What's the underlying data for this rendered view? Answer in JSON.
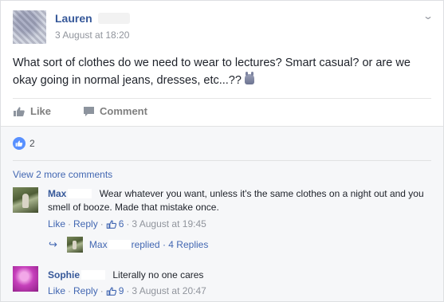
{
  "post": {
    "author": "Lauren",
    "time": "3 August at 18:20",
    "text": "What sort of clothes do we need to wear to lectures? Smart casual? or are we okay going in normal jeans, dresses, etc...??",
    "emoji_icon": "bunny-emoji-icon"
  },
  "actions": {
    "like": "Like",
    "comment": "Comment"
  },
  "reactions": {
    "count": "2"
  },
  "view_more": "View 2 more comments",
  "comments": [
    {
      "name": "Max",
      "text": "Wear whatever you want, unless it's the same clothes on a night out and you smell of booze. Made that mistake once.",
      "like": "Like",
      "reply": "Reply",
      "likes": "6",
      "time": "3 August at 19:45",
      "reply_summary": {
        "name": "Max",
        "replied": "replied",
        "separator": "·",
        "replies": "4 Replies"
      }
    },
    {
      "name": "Sophie",
      "text": "Literally no one cares",
      "like": "Like",
      "reply": "Reply",
      "likes": "9",
      "time": "3 August at 20:47"
    }
  ],
  "colors": {
    "link": "#365899",
    "accent": "#4267b2",
    "meta": "#90949c"
  }
}
